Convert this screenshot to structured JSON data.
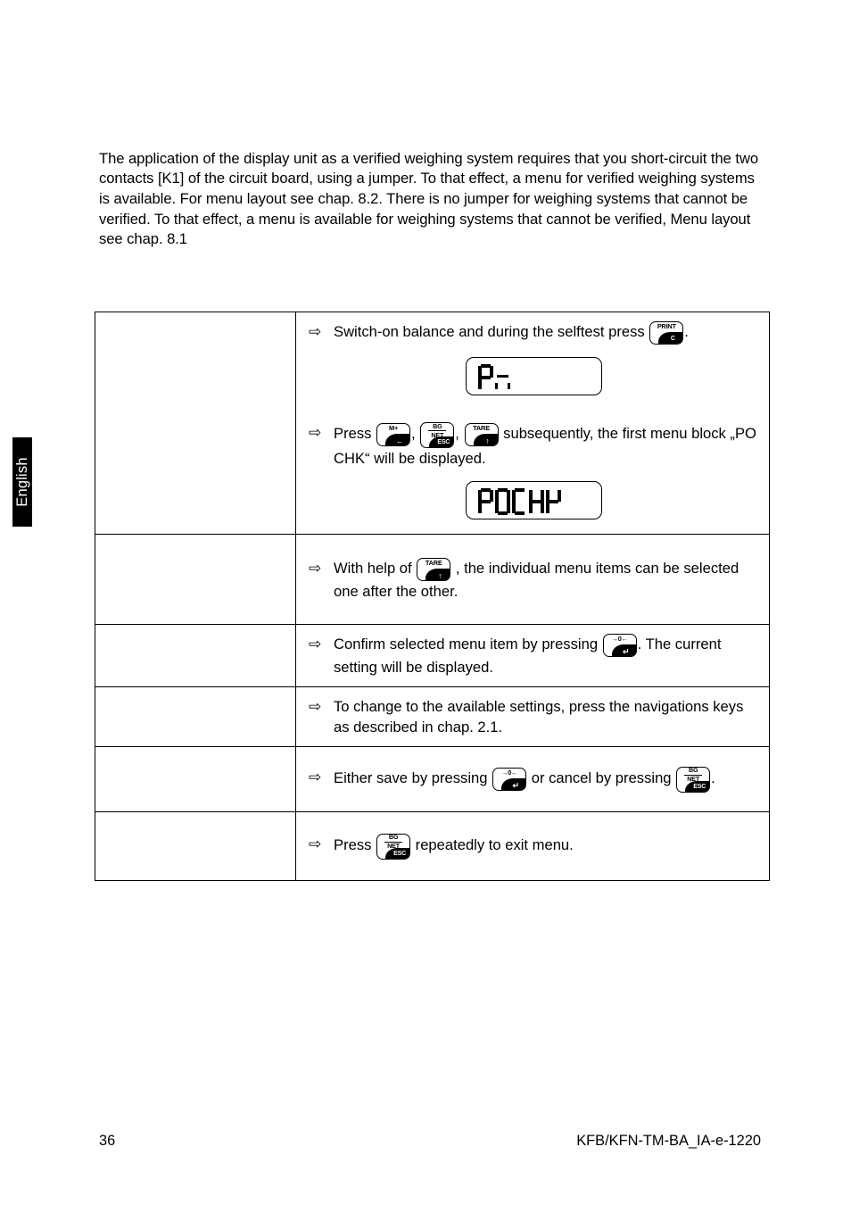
{
  "page": {
    "intro_paragraph": "The application of the display unit as a verified weighing system requires that you short-circuit the two contacts [K1] of the circuit board, using a jumper. To that effect, a menu for verified weighing systems is available. For menu layout see chap. 8.2. There is no jumper for weighing systems that cannot be verified. To that effect, a menu is available for weighing systems that cannot be verified, Menu layout see chap. 8.1",
    "language_tab": "English",
    "bullet_glyph": "⇨"
  },
  "keys": {
    "print": {
      "top_label": "PRINT",
      "sub_label": "C",
      "name": "print-key"
    },
    "m_plus": {
      "top_label": "M+",
      "sub_label": "←",
      "name": "m-plus-key"
    },
    "bg_net": {
      "top_label_1": "BG",
      "top_label_2": "NET",
      "sub_label": "ESC",
      "name": "bg-net-esc-key"
    },
    "tare": {
      "top_label": "TARE",
      "sub_label": "↑",
      "name": "tare-key"
    },
    "zero": {
      "top_label": "→0←",
      "sub_label": "↵",
      "name": "zero-enter-key"
    }
  },
  "displays": {
    "pn": {
      "text": "Pn",
      "chars": [
        "P",
        "n"
      ]
    },
    "pochk": {
      "text": "POCHK",
      "chars": [
        "P",
        "O",
        "C",
        "H",
        "K"
      ]
    }
  },
  "steps": {
    "step1_part1": "Switch-on balance and during the selftest press",
    "step1_part2": ".",
    "step2_part1": "Press",
    "step2_sep1": ",",
    "step2_sep2": ",",
    "step2_part2": "subsequently, the first menu block „PO CHK“ will be displayed.",
    "step3_part1": "With help of",
    "step3_part2": ", the individual menu items can be selected one after the other.",
    "step4_part1": "Confirm selected menu item by pressing",
    "step4_part2": ". The current setting will be displayed.",
    "step5": "To change to the available settings, press the navigations keys as described in chap. 2.1.",
    "step6_part1": "Either save by pressing",
    "step6_part2": "or cancel by pressing",
    "step6_part3": ".",
    "step7_part1": "Press",
    "step7_part2": "repeatedly to exit menu."
  },
  "footer": {
    "page_number": "36",
    "document_reference": "KFB/KFN-TM-BA_IA-e-1220"
  }
}
